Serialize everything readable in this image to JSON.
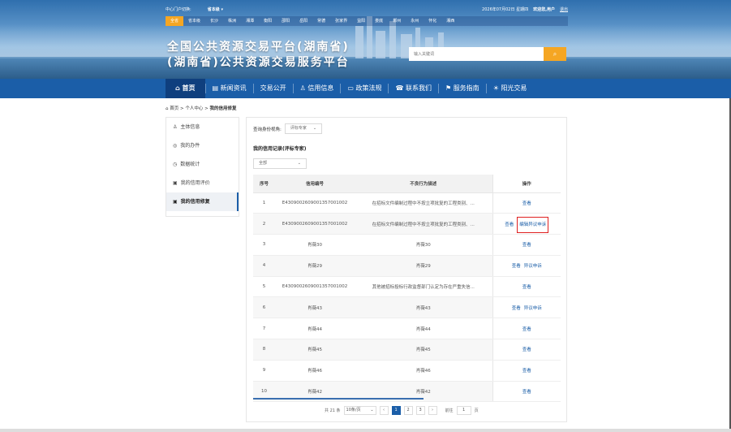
{
  "header": {
    "switch_label": "中心门户切换:",
    "switch_value": "省本级",
    "date": "2026年07月02日 星期四",
    "welcome": "欢迎您,用户",
    "logout": "退出",
    "cities": [
      "全省",
      "省本级",
      "长沙",
      "株洲",
      "湘潭",
      "衡阳",
      "邵阳",
      "岳阳",
      "常德",
      "张家界",
      "益阳",
      "娄底",
      "郴州",
      "永州",
      "怀化",
      "湘西"
    ],
    "title_line1": "全国公共资源交易平台(湖南省)",
    "title_line2": "(湖南省)公共资源交易服务平台",
    "search_placeholder": "输入关键词"
  },
  "nav": {
    "items": [
      {
        "label": "首页",
        "icon": "home-icon"
      },
      {
        "label": "新闻资讯",
        "icon": "news-icon"
      },
      {
        "label": "交易公开",
        "icon": ""
      },
      {
        "label": "信用信息",
        "icon": "credit-icon"
      },
      {
        "label": "政策法规",
        "icon": "policy-icon"
      },
      {
        "label": "联系我们",
        "icon": "contact-icon"
      },
      {
        "label": "服务指南",
        "icon": "guide-icon"
      },
      {
        "label": "阳光交易",
        "icon": "sun-icon"
      }
    ]
  },
  "breadcrumb": {
    "home": "首页",
    "sep": ">",
    "level2": "个人中心",
    "current": "我的信用修复"
  },
  "sidebar": {
    "items": [
      {
        "label": "主体信息",
        "glyph": "♙"
      },
      {
        "label": "我的办件",
        "glyph": "◎"
      },
      {
        "label": "数据统计",
        "glyph": "◷"
      },
      {
        "label": "我的信用评价",
        "glyph": "▣"
      },
      {
        "label": "我的信用修复",
        "glyph": "▣"
      }
    ]
  },
  "main": {
    "filter_label": "查询身份视角:",
    "filter_value": "评标专家",
    "record_title": "我的信用记录(评标专家)",
    "scope_value": "全部",
    "columns": [
      "序号",
      "信用编号",
      "不良行为描述",
      "操作"
    ],
    "rows": [
      {
        "no": "1",
        "code": "E4309002609001357001002",
        "desc": "在招标文件编制过程中不按立项批复的工程类别、...",
        "ops": [
          "查看"
        ]
      },
      {
        "no": "2",
        "code": "E4309002609001357001002",
        "desc": "在招标文件编制过程中不按立项批复的工程类别、...",
        "ops": [
          "查看",
          "编辑异议申诉"
        ]
      },
      {
        "no": "3",
        "code": "肖薇30",
        "desc": "肖薇30",
        "ops": [
          "查看"
        ]
      },
      {
        "no": "4",
        "code": "肖薇29",
        "desc": "肖薇29",
        "ops": [
          "查看",
          "异议申诉"
        ]
      },
      {
        "no": "5",
        "code": "E4309002609001357001002",
        "desc": "其他被招标投标行政监督部门认定为存在严重失信...",
        "ops": [
          "查看"
        ]
      },
      {
        "no": "6",
        "code": "肖薇43",
        "desc": "肖薇43",
        "ops": [
          "查看",
          "异议申诉"
        ]
      },
      {
        "no": "7",
        "code": "肖薇44",
        "desc": "肖薇44",
        "ops": [
          "查看"
        ]
      },
      {
        "no": "8",
        "code": "肖薇45",
        "desc": "肖薇45",
        "ops": [
          "查看"
        ]
      },
      {
        "no": "9",
        "code": "肖薇46",
        "desc": "肖薇46",
        "ops": [
          "查看"
        ]
      },
      {
        "no": "10",
        "code": "肖薇42",
        "desc": "肖薇42",
        "ops": [
          "查看"
        ]
      }
    ],
    "pagination": {
      "total": "共 21 条",
      "page_size": "10条/页",
      "pages": [
        "1",
        "2",
        "3"
      ],
      "current": "1",
      "goto_label": "前往",
      "goto_value": "1",
      "page_unit": "页"
    }
  },
  "colors": {
    "nav_bg": "#1b5ea8",
    "nav_active": "#0f3f7e",
    "accent": "#f5a623",
    "highlight_border": "#e02020"
  }
}
